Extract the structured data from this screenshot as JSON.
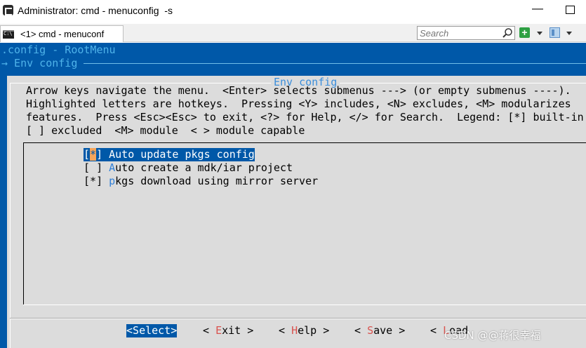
{
  "window": {
    "title": "Administrator: cmd - menuconfig  -s"
  },
  "tabbar": {
    "tab_label": "<1> cmd - menuconf",
    "search_placeholder": "Search"
  },
  "breadcrumb": {
    "line1": ".config - RootMenu",
    "line2": "→ Env config "
  },
  "dialog": {
    "title": "Env config",
    "help_lines": [
      "Arrow keys navigate the menu.  <Enter> selects submenus ---> (or empty submenus ----).",
      "Highlighted letters are hotkeys.  Pressing <Y> includes, <N> excludes, <M> modularizes",
      "features.  Press <Esc><Esc> to exit, <?> for Help, </> for Search.  Legend: [*] built-in",
      "[ ] excluded  <M> module  < > module capable"
    ],
    "items": [
      {
        "open": "[",
        "mark": "*",
        "close": "] ",
        "hotkey": "A",
        "rest": "uto update pkgs config",
        "selected": true
      },
      {
        "open": "[",
        "mark": " ",
        "close": "] ",
        "hotkey": "A",
        "rest": "uto create a mdk/iar project",
        "selected": false
      },
      {
        "open": "[",
        "mark": "*",
        "close": "] ",
        "hotkey": "p",
        "rest": "kgs download using mirror server",
        "selected": false
      }
    ],
    "buttons": [
      {
        "pre": "<",
        "hotkey": "S",
        "rest": "elect>",
        "active": true
      },
      {
        "pre": "< ",
        "hotkey": "E",
        "rest": "xit >",
        "active": false
      },
      {
        "pre": "< ",
        "hotkey": "H",
        "rest": "elp >",
        "active": false
      },
      {
        "pre": "< ",
        "hotkey": "S",
        "rest": "ave >",
        "active": false
      },
      {
        "pre": "< ",
        "hotkey": "L",
        "rest": "oad",
        "active": false
      }
    ]
  },
  "watermark": "CSDN @@蒋很幸福",
  "colors": {
    "console_bg": "#0058a8",
    "dialog_bg": "#dcdcdc",
    "hotkey_item": "#2f7fd8",
    "hotkey_button": "#d9534f",
    "cursor": "#f5a55a"
  }
}
